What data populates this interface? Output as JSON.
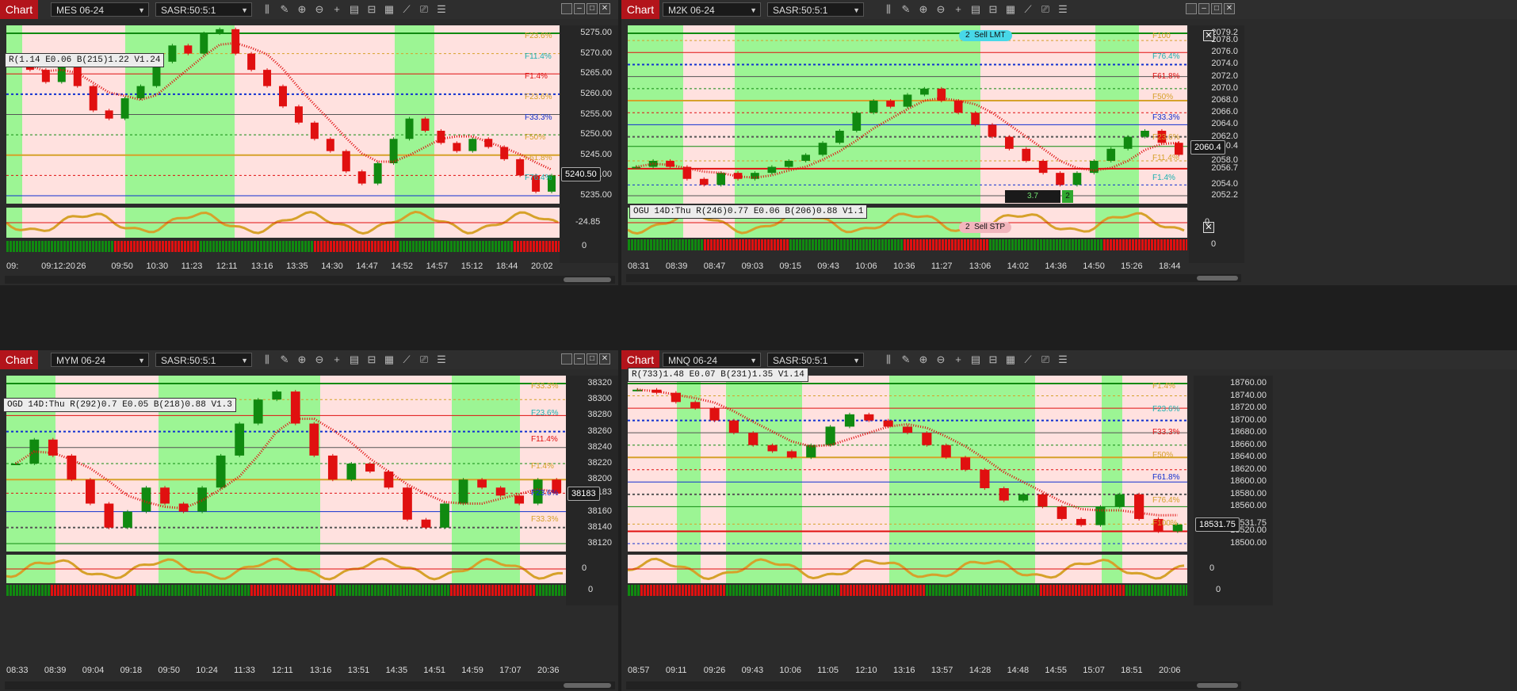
{
  "window": {
    "label": "Chart"
  },
  "icons": [
    "bar-chart-icon",
    "draw-icon",
    "zoom-in-icon",
    "zoom-out-icon",
    "crosshair-icon",
    "properties-icon",
    "template-icon",
    "data-box-icon",
    "indicators-icon",
    "strategy-icon",
    "list-icon"
  ],
  "colors": {
    "bull_shade": "#9cf594",
    "bear_shade": "#ffe1df",
    "red": "#e01010",
    "green": "#108a10",
    "gold": "#d6a12a",
    "axis_bg": "#262626"
  },
  "panels": [
    {
      "id": "mes",
      "symbol": "MES 06-24",
      "indicator": "SASR:50:5:1",
      "yticks": [
        "5275.00",
        "5270.00",
        "5265.00",
        "5260.00",
        "5255.00",
        "5250.00",
        "5245.00",
        "5240.00",
        "5235.00"
      ],
      "price_label": "5240.50",
      "osc_label": "-24.85",
      "zero_label": "0",
      "times": [
        "09:",
        "09:12:20",
        "26",
        "09:50",
        "10:30",
        "11:23",
        "12:11",
        "13:16",
        "13:35",
        "14:30",
        "14:47",
        "14:52",
        "14:57",
        "15:12",
        "18:44",
        "20:02"
      ],
      "info": "R(1.14 E0.06 B(215)1.22 V1.24",
      "fib_labels": [
        "F23.6%",
        "F11.4%",
        "F1.4%",
        "F23.6%",
        "F33.3%",
        "F50%",
        "F61.8%",
        "F76.4%"
      ],
      "price_points": [
        5268,
        5266,
        5263,
        5267,
        5262,
        5256,
        5254,
        5259,
        5262,
        5268,
        5272,
        5270,
        5275,
        5276,
        5270,
        5266,
        5262,
        5257,
        5253,
        5249,
        5246,
        5241,
        5238,
        5243,
        5249,
        5254,
        5251,
        5248,
        5246,
        5249,
        5247,
        5244,
        5240,
        5236,
        5240
      ]
    },
    {
      "id": "m2k",
      "symbol": "M2K 06-24",
      "indicator": "SASR:50:5:1",
      "yticks": [
        "2079.2",
        "2078.0",
        "2076.0",
        "2074.0",
        "2072.0",
        "2070.0",
        "2068.0",
        "2066.0",
        "2064.0",
        "2062.0",
        "2060.4",
        "2058.0",
        "2056.7",
        "2054.0",
        "2052.2"
      ],
      "price_label": "2060.4",
      "osc_label": "0",
      "zero_label": "0",
      "times": [
        "08:31",
        "08:39",
        "08:47",
        "09:03",
        "09:15",
        "09:43",
        "10:06",
        "10:36",
        "11:27",
        "13:06",
        "14:02",
        "14:36",
        "14:50",
        "15:26",
        "18:44"
      ],
      "info": "OGU 14D:Thu R(246)0.77 E0.06 B(206)0.88 V1.1",
      "order_top": {
        "qty": "2",
        "text": "Sell LMT",
        "price": "2079.2"
      },
      "order_bottom": {
        "qty": "2",
        "text": "Sell STP",
        "price": "2052.2"
      },
      "pnl": "3.7",
      "pnl_qty": "2",
      "mark_price": "2056.7",
      "fib_labels": [
        "F100",
        "F76.4%",
        "F61.8%",
        "F50%",
        "F33.3%",
        "F23.6%",
        "F11.4%",
        "F1.4%"
      ],
      "price_points": [
        2057,
        2058,
        2057,
        2055,
        2054,
        2056,
        2055,
        2056,
        2057,
        2058,
        2059,
        2061,
        2063,
        2066,
        2068,
        2067,
        2069,
        2070,
        2068,
        2066,
        2064,
        2062,
        2060,
        2058,
        2056,
        2054,
        2056,
        2058,
        2060,
        2062,
        2063,
        2061,
        2059
      ]
    },
    {
      "id": "mym",
      "symbol": "MYM 06-24",
      "indicator": "SASR:50:5:1",
      "yticks": [
        "38320",
        "38300",
        "38280",
        "38260",
        "38240",
        "38220",
        "38200",
        "38183",
        "38160",
        "38140",
        "38120"
      ],
      "price_label": "38183",
      "osc_label": "0",
      "zero_label": "0",
      "times": [
        "08:33",
        "08:39",
        "09:04",
        "09:18",
        "09:50",
        "10:24",
        "11:33",
        "12:11",
        "13:16",
        "13:51",
        "14:35",
        "14:51",
        "14:59",
        "17:07",
        "20:36"
      ],
      "info": "OGD 14D:Thu R(292)0.7 E0.05 B(218)0.88 V1.3",
      "fib_labels": [
        "F33.3%",
        "F23.6%",
        "F11.4%",
        "F1.4%",
        "F23.6%",
        "F33.3%"
      ],
      "price_points": [
        38220,
        38250,
        38230,
        38200,
        38170,
        38140,
        38160,
        38190,
        38170,
        38160,
        38190,
        38230,
        38270,
        38300,
        38310,
        38270,
        38230,
        38200,
        38220,
        38210,
        38190,
        38150,
        38140,
        38170,
        38200,
        38190,
        38180,
        38170,
        38200,
        38183
      ]
    },
    {
      "id": "mnq",
      "symbol": "MNQ 06-24",
      "indicator": "SASR:50:5:1",
      "yticks": [
        "18760.00",
        "18740.00",
        "18720.00",
        "18700.00",
        "18680.00",
        "18660.00",
        "18640.00",
        "18620.00",
        "18600.00",
        "18580.00",
        "18560.00",
        "18531.75",
        "18520.00",
        "18500.00"
      ],
      "price_label": "18531.75",
      "osc_label": "0",
      "zero_label": "0",
      "times": [
        "08:57",
        "09:11",
        "09:26",
        "09:43",
        "10:06",
        "11:05",
        "12:10",
        "13:16",
        "13:57",
        "14:28",
        "14:48",
        "14:55",
        "15:07",
        "18:51",
        "20:06"
      ],
      "info": "R(733)1.48 E0.07 B(231)1.35 V1.14",
      "fib_labels": [
        "F1.4%",
        "F23.6%",
        "F33.3%",
        "F50%",
        "F61.8%",
        "F76.4%",
        "F100%"
      ],
      "price_points": [
        18750,
        18745,
        18730,
        18720,
        18700,
        18680,
        18660,
        18650,
        18640,
        18660,
        18690,
        18710,
        18700,
        18690,
        18680,
        18660,
        18640,
        18620,
        18590,
        18570,
        18580,
        18560,
        18540,
        18530,
        18560,
        18580,
        18540,
        18520,
        18531
      ]
    }
  ]
}
